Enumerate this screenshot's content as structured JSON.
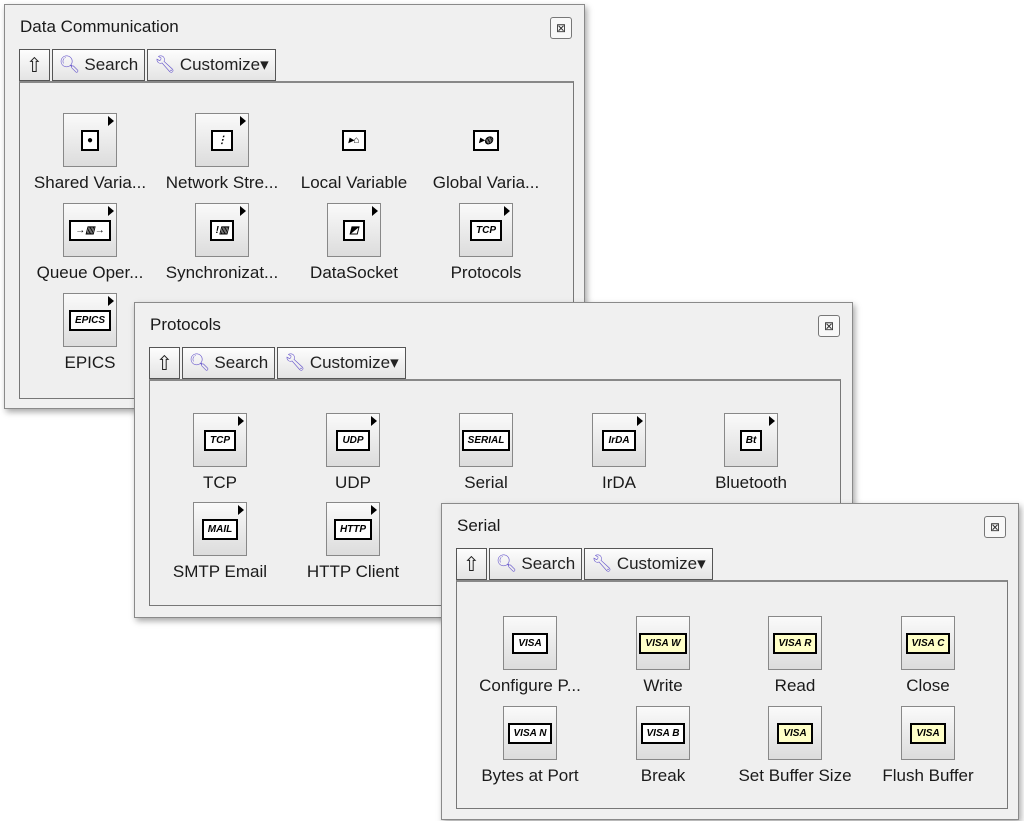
{
  "windows": [
    {
      "id": "data-communication",
      "title": "Data Communication",
      "close": "⊠",
      "toolbar": {
        "up": "⇧",
        "search": "Search",
        "customize": "Customize▾"
      },
      "items": [
        {
          "label": "Shared Varia...",
          "icon": "shared-variable",
          "glyph": "●",
          "submenu": true
        },
        {
          "label": "Network Stre...",
          "icon": "network-stream",
          "glyph": "⋮",
          "submenu": true
        },
        {
          "label": "Local Variable",
          "icon": "local-variable",
          "glyph": "▸⌂",
          "submenu": false
        },
        {
          "label": "Global Varia...",
          "icon": "global-variable",
          "glyph": "▸◍",
          "submenu": false
        },
        {
          "label": "Queue Oper...",
          "icon": "queue-operations",
          "glyph": "→▥→",
          "submenu": true
        },
        {
          "label": "Synchronizat...",
          "icon": "synchronization",
          "glyph": "!▥",
          "submenu": true
        },
        {
          "label": "DataSocket",
          "icon": "datasocket",
          "glyph": "◩",
          "submenu": true
        },
        {
          "label": "Protocols",
          "icon": "protocols",
          "glyph": "TCP",
          "submenu": true
        },
        {
          "label": "EPICS",
          "icon": "epics",
          "glyph": "EPICS",
          "submenu": true
        }
      ]
    },
    {
      "id": "protocols",
      "title": "Protocols",
      "close": "⊠",
      "toolbar": {
        "up": "⇧",
        "search": "Search",
        "customize": "Customize▾"
      },
      "items": [
        {
          "label": "TCP",
          "icon": "tcp",
          "glyph": "TCP",
          "submenu": true
        },
        {
          "label": "UDP",
          "icon": "udp",
          "glyph": "UDP",
          "submenu": true
        },
        {
          "label": "Serial",
          "icon": "serial",
          "glyph": "SERIAL",
          "submenu": false
        },
        {
          "label": "IrDA",
          "icon": "irda",
          "glyph": "IrDA",
          "submenu": true
        },
        {
          "label": "Bluetooth",
          "icon": "bluetooth",
          "glyph": "Bt",
          "submenu": true
        },
        {
          "label": "SMTP Email",
          "icon": "smtp-email",
          "glyph": "MAIL",
          "submenu": true
        },
        {
          "label": "HTTP Client",
          "icon": "http-client",
          "glyph": "HTTP",
          "submenu": true
        }
      ]
    },
    {
      "id": "serial",
      "title": "Serial",
      "close": "⊠",
      "toolbar": {
        "up": "⇧",
        "search": "Search",
        "customize": "Customize▾"
      },
      "items": [
        {
          "label": "Configure P...",
          "icon": "visa-configure-port",
          "glyph": "VISA",
          "submenu": false
        },
        {
          "label": "Write",
          "icon": "visa-write",
          "glyph": "VISA W",
          "submenu": false,
          "yellow": true
        },
        {
          "label": "Read",
          "icon": "visa-read",
          "glyph": "VISA R",
          "submenu": false,
          "yellow": true
        },
        {
          "label": "Close",
          "icon": "visa-close",
          "glyph": "VISA C",
          "submenu": false,
          "yellow": true
        },
        {
          "label": "Bytes at Port",
          "icon": "visa-bytes-at-port",
          "glyph": "VISA N",
          "submenu": false
        },
        {
          "label": "Break",
          "icon": "visa-break",
          "glyph": "VISA B",
          "submenu": false
        },
        {
          "label": "Set Buffer Size",
          "icon": "visa-set-buffer-size",
          "glyph": "VISA",
          "submenu": false,
          "yellow": true
        },
        {
          "label": "Flush Buffer",
          "icon": "visa-flush-buffer",
          "glyph": "VISA",
          "submenu": false,
          "yellow": true
        }
      ]
    }
  ]
}
